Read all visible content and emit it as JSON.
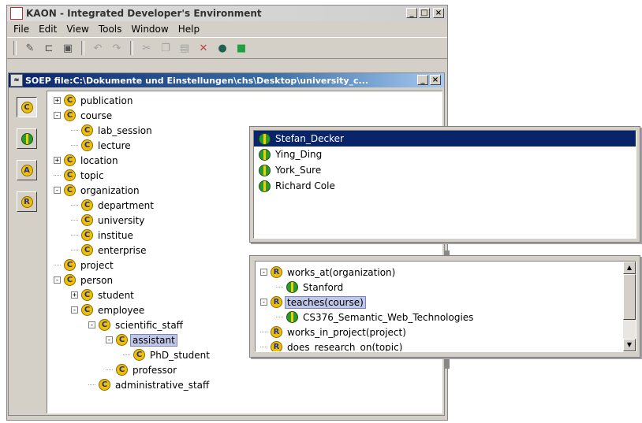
{
  "app": {
    "title": "KAON - Integrated Developer's Environment",
    "menu": [
      "File",
      "Edit",
      "View",
      "Tools",
      "Window",
      "Help"
    ]
  },
  "inner_window": {
    "title": "SOEP file:C:\\Dokumente und Einstellungen\\chs\\Desktop\\university_c..."
  },
  "window_buttons": {
    "minimize": "_",
    "maximize": "□",
    "close": "×"
  },
  "sidebar_buttons": [
    "concepts-view",
    "instances-view",
    "attributes-view",
    "relations-view"
  ],
  "concept_tree": [
    {
      "label": "publication",
      "depth": 0,
      "toggle": "+"
    },
    {
      "label": "course",
      "depth": 0,
      "toggle": "-"
    },
    {
      "label": "lab_session",
      "depth": 1,
      "toggle": ""
    },
    {
      "label": "lecture",
      "depth": 1,
      "toggle": ""
    },
    {
      "label": "location",
      "depth": 0,
      "toggle": "+"
    },
    {
      "label": "topic",
      "depth": 0,
      "toggle": ""
    },
    {
      "label": "organization",
      "depth": 0,
      "toggle": "-"
    },
    {
      "label": "department",
      "depth": 1,
      "toggle": ""
    },
    {
      "label": "university",
      "depth": 1,
      "toggle": ""
    },
    {
      "label": "institue",
      "depth": 1,
      "toggle": ""
    },
    {
      "label": "enterprise",
      "depth": 1,
      "toggle": ""
    },
    {
      "label": "project",
      "depth": 0,
      "toggle": ""
    },
    {
      "label": "person",
      "depth": 0,
      "toggle": "-"
    },
    {
      "label": "student",
      "depth": 1,
      "toggle": "+"
    },
    {
      "label": "employee",
      "depth": 1,
      "toggle": "-"
    },
    {
      "label": "scientific_staff",
      "depth": 2,
      "toggle": "-"
    },
    {
      "label": "assistant",
      "depth": 3,
      "toggle": "-",
      "selected": true
    },
    {
      "label": "PhD_student",
      "depth": 4,
      "toggle": ""
    },
    {
      "label": "professor",
      "depth": 3,
      "toggle": ""
    },
    {
      "label": "administrative_staff",
      "depth": 2,
      "toggle": ""
    }
  ],
  "instances": [
    {
      "label": "Stefan_Decker",
      "selected": true
    },
    {
      "label": "Ying_Ding",
      "selected": false
    },
    {
      "label": "York_Sure",
      "selected": false
    },
    {
      "label": "Richard Cole",
      "selected": false
    }
  ],
  "relations": [
    {
      "label": "works_at(organization)",
      "kind": "relation",
      "toggle": "-"
    },
    {
      "label": "Stanford",
      "kind": "instance",
      "toggle": ""
    },
    {
      "label": "teaches(course)",
      "kind": "relation",
      "toggle": "-",
      "highlight": true
    },
    {
      "label": "CS376_Semantic_Web_Technologies",
      "kind": "instance",
      "toggle": ""
    },
    {
      "label": "works_in_project(project)",
      "kind": "relation",
      "toggle": ""
    },
    {
      "label": "does_research_on(topic)",
      "kind": "relation",
      "toggle": ""
    }
  ],
  "icons": {
    "concept": "C",
    "relation": "R",
    "attribute": "A"
  }
}
